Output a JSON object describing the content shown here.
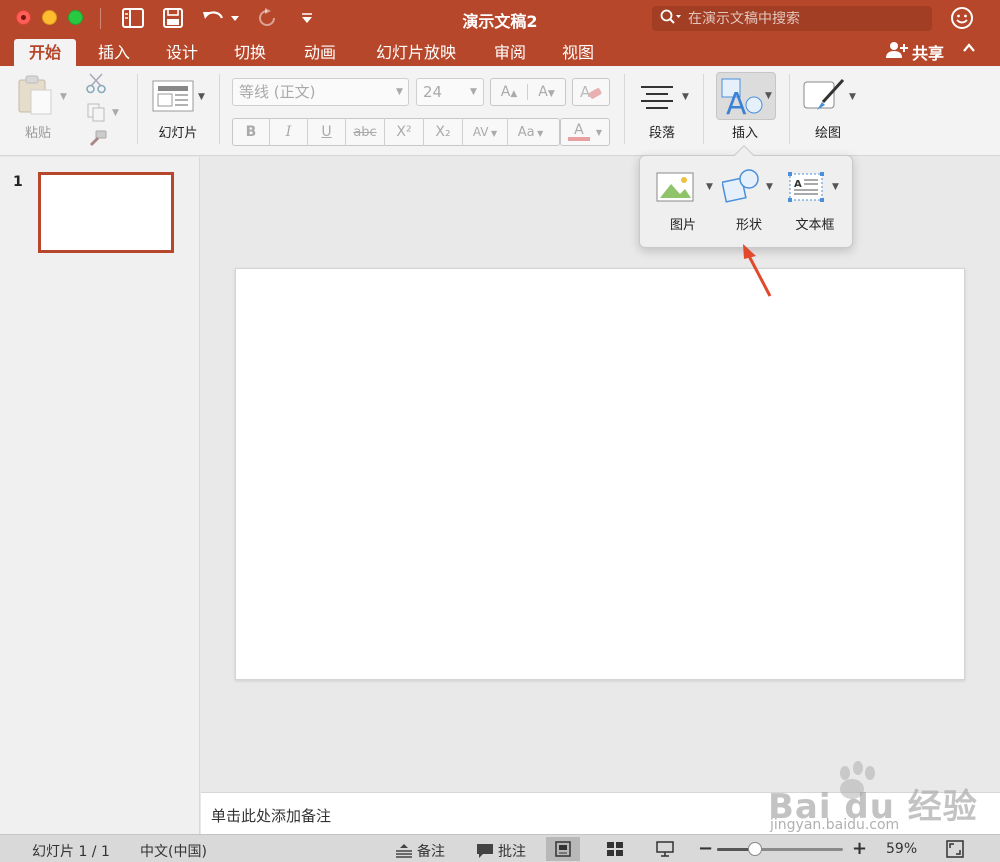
{
  "titlebar": {
    "title": "演示文稿2",
    "search_placeholder": "在演示文稿中搜索"
  },
  "tabs": [
    {
      "label": "开始",
      "active": true
    },
    {
      "label": "插入"
    },
    {
      "label": "设计"
    },
    {
      "label": "切换"
    },
    {
      "label": "动画"
    },
    {
      "label": "幻灯片放映"
    },
    {
      "label": "审阅"
    },
    {
      "label": "视图"
    }
  ],
  "share_label": "共享",
  "ribbon": {
    "paste_label": "粘贴",
    "slide_label": "幻灯片",
    "font_name": "等线 (正文)",
    "font_size": "24",
    "paragraph_label": "段落",
    "insert_label": "插入",
    "drawing_label": "绘图",
    "format_buttons": {
      "bold": "B",
      "italic": "I",
      "underline": "U",
      "strike": "abc",
      "superscript": "X²",
      "subscript": "X₂",
      "spacing": "AV",
      "case": "Aa",
      "font_color": "A",
      "grow": "A",
      "shrink": "A"
    }
  },
  "insert_popover": {
    "items": [
      {
        "label": "图片"
      },
      {
        "label": "形状"
      },
      {
        "label": "文本框"
      }
    ]
  },
  "slides": {
    "thumb_number": "1"
  },
  "notes_placeholder": "单击此处添加备注",
  "status": {
    "slide_info": "幻灯片 1 / 1",
    "language": "中文(中国)",
    "notes_label": "备注",
    "comments_label": "批注",
    "zoom_minus": "−",
    "zoom_plus": "+",
    "zoom_level": "59%",
    "zoom_fraction": 0.3
  },
  "watermark": {
    "brand": "Bai du 经验",
    "url": "jingyan.baidu.com"
  },
  "colors": {
    "accent": "#b7472a",
    "annotation_arrow": "#e2482c"
  }
}
